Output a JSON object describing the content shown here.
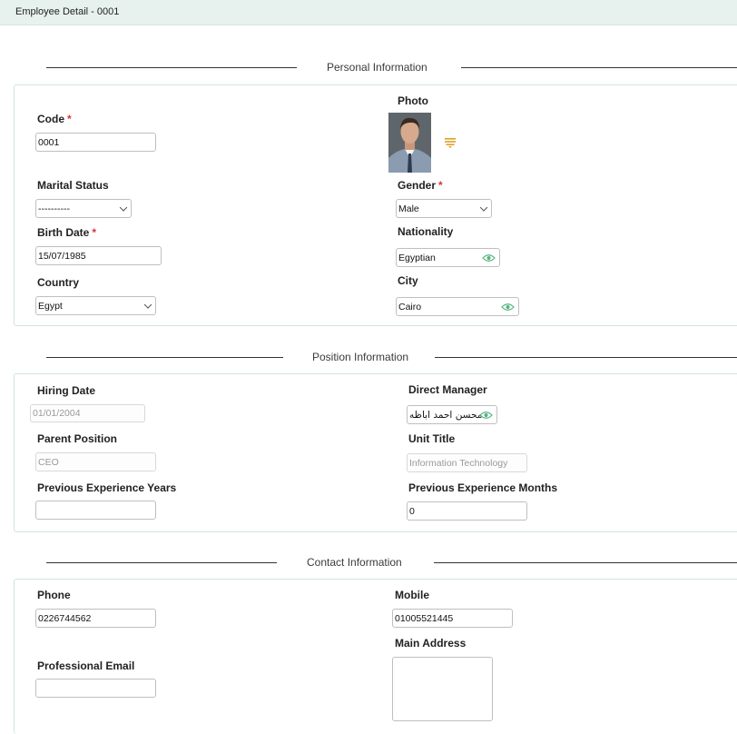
{
  "window": {
    "title": "Employee Detail - 0001"
  },
  "sections": {
    "personal": "Personal Information",
    "position": "Position Information",
    "contact": "Contact Information"
  },
  "personal": {
    "code_label": "Code",
    "code_value": "0001",
    "photo_label": "Photo",
    "photo_menu_icon": "list-icon",
    "marital_label": "Marital Status",
    "marital_value": "----------",
    "gender_label": "Gender",
    "gender_value": "Male",
    "birth_label": "Birth Date",
    "birth_value": "15/07/1985",
    "nationality_label": "Nationality",
    "nationality_value": "Egyptian",
    "country_label": "Country",
    "country_value": "Egypt",
    "city_label": "City",
    "city_value": "Cairo",
    "required_mark": "*"
  },
  "position": {
    "hiring_label": "Hiring Date",
    "hiring_value": "01/01/2004",
    "manager_label": "Direct Manager",
    "manager_value": "محسن احمد اباظه",
    "parent_label": "Parent Position",
    "parent_value": "CEO",
    "unit_label": "Unit Title",
    "unit_value": "Information Technology",
    "prev_years_label": "Previous Experience Years",
    "prev_years_value": "",
    "prev_months_label": "Previous Experience Months",
    "prev_months_value": "0"
  },
  "contact": {
    "phone_label": "Phone",
    "phone_value": "0226744562",
    "mobile_label": "Mobile",
    "mobile_value": "01005521445",
    "email_label": "Professional Email",
    "email_value": "",
    "address_label": "Main Address",
    "address_value": ""
  },
  "colors": {
    "titlebar_bg": "#e7f2ee",
    "panel_border": "#cde5dc",
    "required": "#dd3333",
    "eye_icon": "#55b480",
    "photo_menu": "#e0a020"
  }
}
